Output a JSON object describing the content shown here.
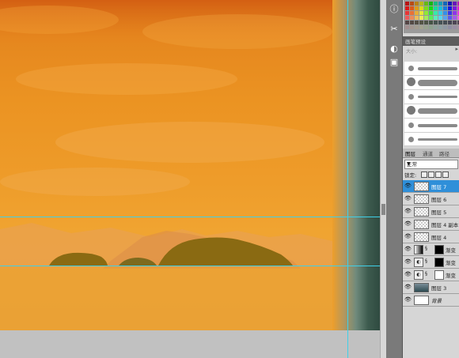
{
  "panels": {
    "brushes": {
      "tab_label": "画笔预设",
      "size_label": "大小:",
      "menu_icon": "▸"
    },
    "layers": {
      "tabs": [
        "图层",
        "通道",
        "路径"
      ],
      "blend_mode": "正常",
      "lock_label": "锁定:",
      "items": [
        {
          "name": "图层 7",
          "selected": true
        },
        {
          "name": "图层 6",
          "selected": false
        },
        {
          "name": "图层 5",
          "selected": false
        },
        {
          "name": "图层 4 副本",
          "selected": false
        },
        {
          "name": "图层 4",
          "selected": false
        },
        {
          "name": "渐变",
          "selected": false
        },
        {
          "name": "渐变",
          "selected": false
        },
        {
          "name": "渐变",
          "selected": false
        },
        {
          "name": "图层 3",
          "selected": false
        },
        {
          "name": "背景",
          "selected": false
        }
      ]
    }
  },
  "colors": {
    "sky_top": "#d9761b",
    "sky_bottom": "#eba035",
    "hills": "#8a6a12",
    "guide": "#3fd0e8",
    "selected_layer": "#2f8fd9"
  },
  "tools": [
    "info-icon",
    "scissors-icon",
    "palette-icon",
    "screen-icon"
  ]
}
